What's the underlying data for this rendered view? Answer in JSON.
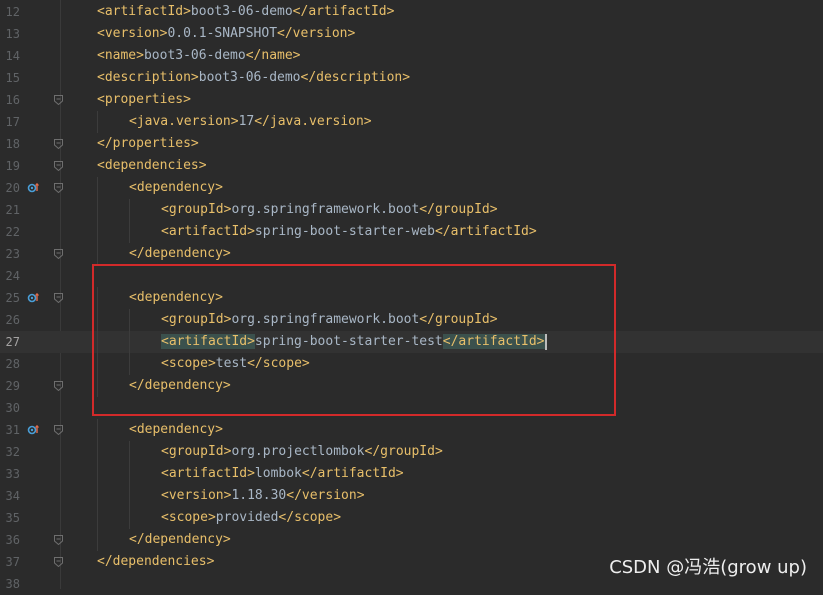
{
  "colors": {
    "background": "#2b2b2b",
    "tag": "#e8bf6a",
    "text": "#a9b7c6",
    "line_number": "#606366",
    "highlight_box": "#d22a2a",
    "current_line": "#323232"
  },
  "lines": [
    {
      "num": "12",
      "indent": 0,
      "open": "artifactId",
      "text": "boot3-06-demo",
      "close": "artifactId"
    },
    {
      "num": "13",
      "indent": 0,
      "open": "version",
      "text": "0.0.1-SNAPSHOT",
      "close": "version"
    },
    {
      "num": "14",
      "indent": 0,
      "open": "name",
      "text": "boot3-06-demo",
      "close": "name"
    },
    {
      "num": "15",
      "indent": 0,
      "open": "description",
      "text": "boot3-06-demo",
      "close": "description"
    },
    {
      "num": "16",
      "indent": 0,
      "open": "properties",
      "fold": true
    },
    {
      "num": "17",
      "indent": 1,
      "open": "java.version",
      "text": "17",
      "close": "java.version"
    },
    {
      "num": "18",
      "indent": 0,
      "close": "properties",
      "fold": true
    },
    {
      "num": "19",
      "indent": 0,
      "open": "dependencies",
      "fold": true
    },
    {
      "num": "20",
      "indent": 1,
      "open": "dependency",
      "fold": true,
      "marker": true
    },
    {
      "num": "21",
      "indent": 2,
      "open": "groupId",
      "text": "org.springframework.boot",
      "close": "groupId"
    },
    {
      "num": "22",
      "indent": 2,
      "open": "artifactId",
      "text": "spring-boot-starter-web",
      "close": "artifactId"
    },
    {
      "num": "23",
      "indent": 1,
      "close": "dependency",
      "fold": true
    },
    {
      "num": "24",
      "indent": 0
    },
    {
      "num": "25",
      "indent": 1,
      "open": "dependency",
      "fold": true,
      "marker": true
    },
    {
      "num": "26",
      "indent": 2,
      "open": "groupId",
      "text": "org.springframework.boot",
      "close": "groupId"
    },
    {
      "num": "27",
      "indent": 2,
      "open": "artifactId",
      "text": "spring-boot-starter-test",
      "close": "artifactId",
      "current": true
    },
    {
      "num": "28",
      "indent": 2,
      "open": "scope",
      "text": "test",
      "close": "scope"
    },
    {
      "num": "29",
      "indent": 1,
      "close": "dependency",
      "fold": true
    },
    {
      "num": "30",
      "indent": 0
    },
    {
      "num": "31",
      "indent": 1,
      "open": "dependency",
      "fold": true,
      "marker": true
    },
    {
      "num": "32",
      "indent": 2,
      "open": "groupId",
      "text": "org.projectlombok",
      "close": "groupId"
    },
    {
      "num": "33",
      "indent": 2,
      "open": "artifactId",
      "text": "lombok",
      "close": "artifactId"
    },
    {
      "num": "34",
      "indent": 2,
      "open": "version",
      "text": "1.18.30",
      "close": "version"
    },
    {
      "num": "35",
      "indent": 2,
      "open": "scope",
      "text": "provided",
      "close": "scope"
    },
    {
      "num": "36",
      "indent": 1,
      "close": "dependency",
      "fold": true
    },
    {
      "num": "37",
      "indent": 0,
      "close": "dependencies",
      "fold": true
    },
    {
      "num": "38",
      "indent": 0
    }
  ],
  "watermark": "CSDN @冯浩(grow up)"
}
